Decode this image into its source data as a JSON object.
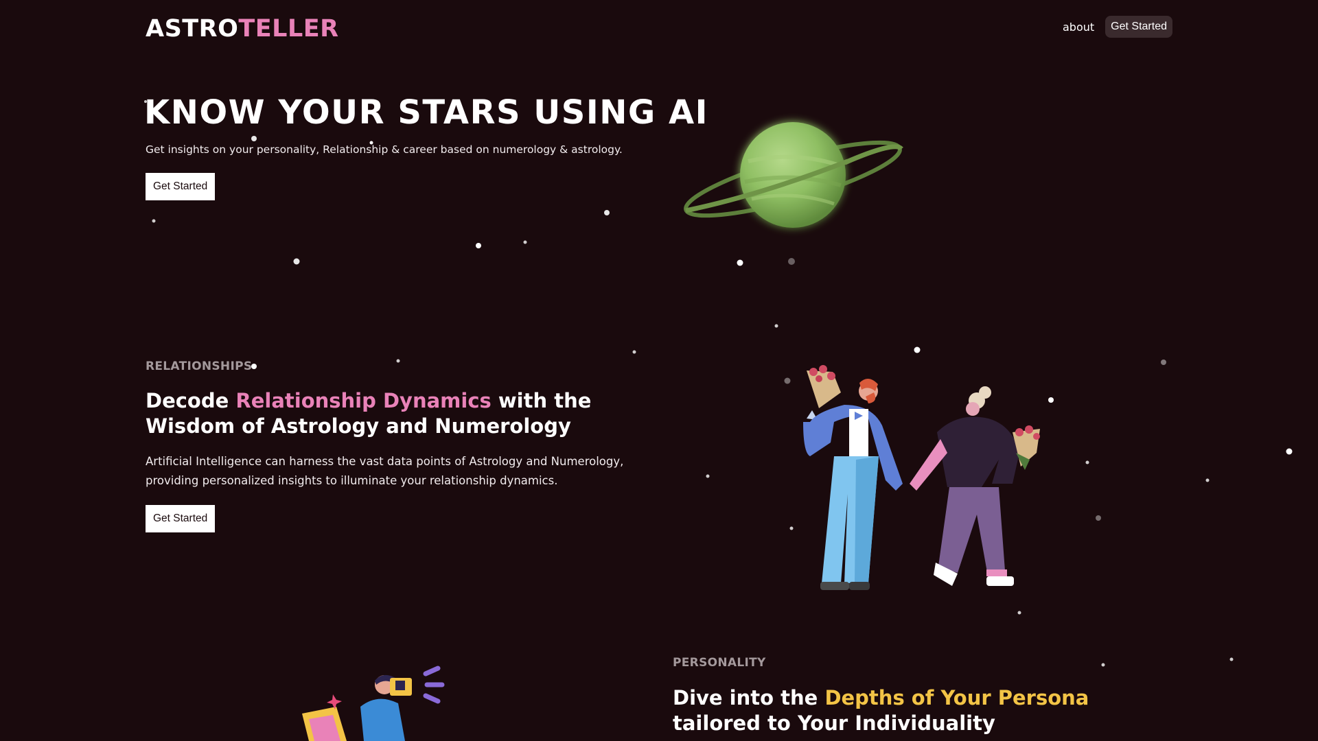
{
  "header": {
    "logo_part1": "ASTRO",
    "logo_part2": "TELLER",
    "nav_about": "about",
    "nav_get_started": "Get Started"
  },
  "hero": {
    "title": "KNOW YOUR STARS USING AI",
    "subtitle": "Get insights on your personality, Relationship & career based on numerology & astrology.",
    "cta": "Get Started"
  },
  "relationships": {
    "label": "RELATIONSHIPS",
    "title_pre": "Decode ",
    "title_highlight": "Relationship Dynamics",
    "title_post": " with the Wisdom of Astrology and Numerology",
    "body": "Artificial Intelligence can harness the vast data points of Astrology and Numerology, providing personalized insights to illuminate your relationship dynamics.",
    "cta": "Get Started"
  },
  "personality": {
    "label": "PERSONALITY",
    "title_pre": "Dive into the ",
    "title_highlight": "Depths of Your Persona",
    "title_post": " tailored to Your Individuality"
  },
  "colors": {
    "background": "#1a0a0d",
    "accent_pink": "#e982b8",
    "accent_yellow": "#f3c446",
    "planet_green": "#8fbf63"
  },
  "icons": [
    "saturn-planet-illustration",
    "couple-with-flowers-illustration",
    "photographer-illustration",
    "star-dots"
  ]
}
